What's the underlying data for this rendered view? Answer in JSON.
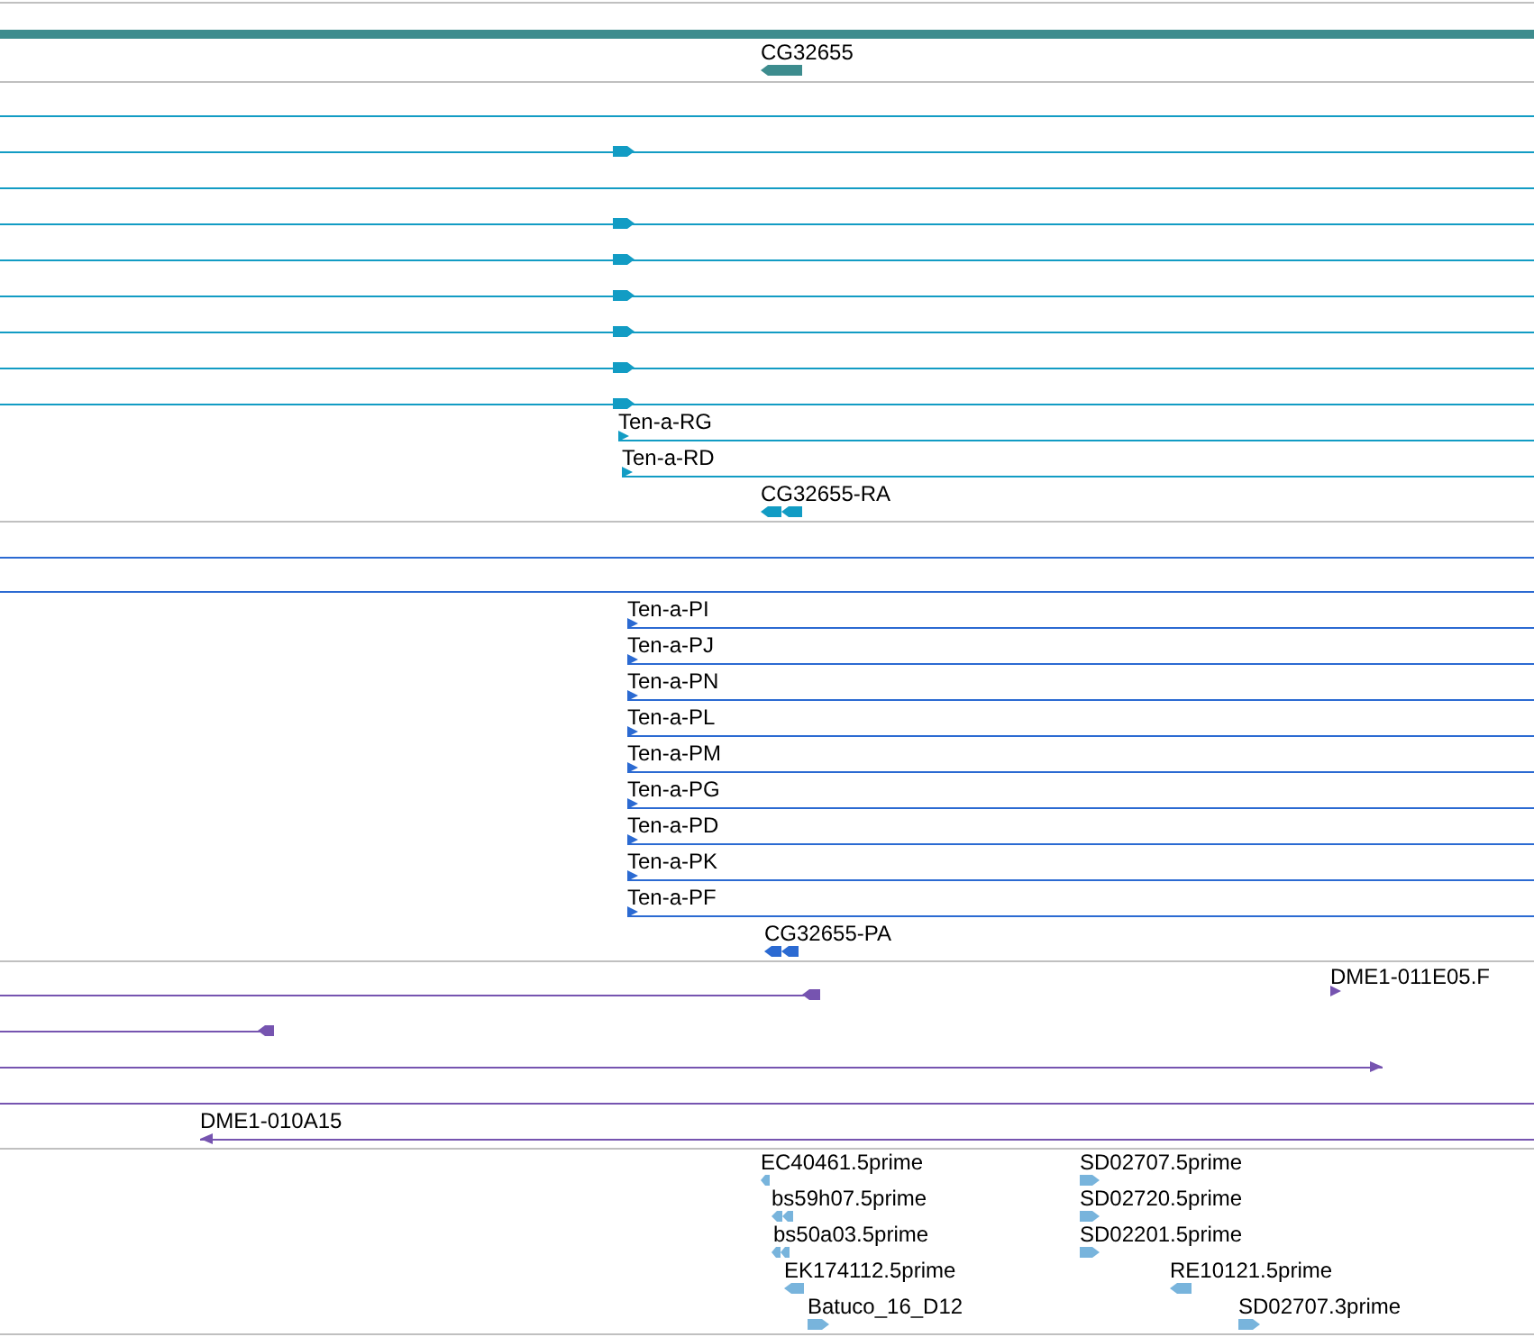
{
  "tracks": [
    {
      "color": "#3d8c8e",
      "features": [
        {
          "kind": "bar"
        },
        {
          "kind": "gene",
          "label": "CG32655",
          "forward": false
        }
      ]
    },
    {
      "color": "#129cc4",
      "features": [
        {
          "kind": "transcript"
        },
        {
          "kind": "transcript",
          "forward": true
        },
        {
          "kind": "transcript"
        },
        {
          "kind": "transcript",
          "forward": true
        },
        {
          "kind": "transcript",
          "forward": true
        },
        {
          "kind": "transcript",
          "forward": true
        },
        {
          "kind": "transcript",
          "forward": true
        },
        {
          "kind": "transcript",
          "forward": true
        },
        {
          "kind": "transcript",
          "forward": true
        },
        {
          "kind": "transcript",
          "label": "Ten-a-RG",
          "forward": true
        },
        {
          "kind": "transcript",
          "label": "Ten-a-RD",
          "forward": true
        },
        {
          "kind": "gene",
          "label": "CG32655-RA",
          "forward": false
        }
      ]
    },
    {
      "color": "#2b6ad2",
      "features": [
        {
          "kind": "transcript"
        },
        {
          "kind": "transcript"
        },
        {
          "kind": "transcript",
          "label": "Ten-a-PI",
          "forward": true
        },
        {
          "kind": "transcript",
          "label": "Ten-a-PJ",
          "forward": true
        },
        {
          "kind": "transcript",
          "label": "Ten-a-PN",
          "forward": true
        },
        {
          "kind": "transcript",
          "label": "Ten-a-PL",
          "forward": true
        },
        {
          "kind": "transcript",
          "label": "Ten-a-PM",
          "forward": true
        },
        {
          "kind": "transcript",
          "label": "Ten-a-PG",
          "forward": true
        },
        {
          "kind": "transcript",
          "label": "Ten-a-PD",
          "forward": true
        },
        {
          "kind": "transcript",
          "label": "Ten-a-PK",
          "forward": true
        },
        {
          "kind": "transcript",
          "label": "Ten-a-PF",
          "forward": true
        },
        {
          "kind": "gene",
          "label": "CG32655-PA",
          "forward": false
        }
      ]
    },
    {
      "color": "#7654b0",
      "features": [
        {
          "kind": "transcript",
          "forward": false
        },
        {
          "kind": "gene",
          "label": "DME1-011E05.F",
          "forward": true
        },
        {
          "kind": "transcript",
          "forward": false
        },
        {
          "kind": "transcript",
          "forward": true
        },
        {
          "kind": "transcript"
        },
        {
          "kind": "transcript",
          "label": "DME1-010A15",
          "forward": false
        }
      ]
    },
    {
      "color": "#78b4dc",
      "features": [
        {
          "kind": "gene",
          "label": "EC40461.5prime",
          "forward": false
        },
        {
          "kind": "gene",
          "label": "bs59h07.5prime",
          "forward": false
        },
        {
          "kind": "gene",
          "label": "bs50a03.5prime",
          "forward": false
        },
        {
          "kind": "gene",
          "label": "EK174112.5prime",
          "forward": false
        },
        {
          "kind": "gene",
          "label": "Batuco_16_D12",
          "forward": true
        },
        {
          "kind": "gene",
          "label": "SD02707.5prime",
          "forward": true
        },
        {
          "kind": "gene",
          "label": "SD02720.5prime",
          "forward": true
        },
        {
          "kind": "gene",
          "label": "SD02201.5prime",
          "forward": true
        },
        {
          "kind": "gene",
          "label": "RE10121.5prime",
          "forward": false
        },
        {
          "kind": "gene",
          "label": "SD02707.3prime",
          "forward": true
        }
      ]
    }
  ]
}
